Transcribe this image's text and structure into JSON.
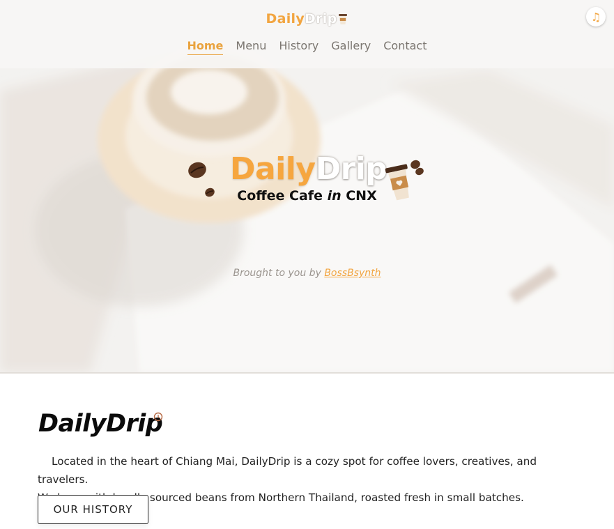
{
  "nav": {
    "brand_part1": "Daily",
    "brand_part2": "Drip",
    "links": [
      {
        "label": "Home",
        "active": true
      },
      {
        "label": "Menu",
        "active": false
      },
      {
        "label": "History",
        "active": false
      },
      {
        "label": "Gallery",
        "active": false
      },
      {
        "label": "Contact",
        "active": false
      }
    ],
    "music_icon": "music-note-icon"
  },
  "hero": {
    "title_part1": "Daily",
    "title_part2": "Drip",
    "subtitle_before": "Coffee Cafe ",
    "subtitle_italic": "in",
    "subtitle_after": " CNX",
    "credit_prefix": "Brought to you by ",
    "credit_link": "BossBsynth"
  },
  "about": {
    "title": "DailyDrip",
    "icon": "clock-icon",
    "line1": "Located in the heart of Chiang Mai, DailyDrip is a cozy spot for coffee lovers, creatives, and travelers.",
    "line2": "We brew with locally sourced beans from Northern Thailand, roasted fresh in small batches.",
    "button_label": "OUR HISTORY"
  },
  "colors": {
    "accent": "#f2a540",
    "text_dark": "#111111",
    "nav_text": "#7b7670"
  }
}
